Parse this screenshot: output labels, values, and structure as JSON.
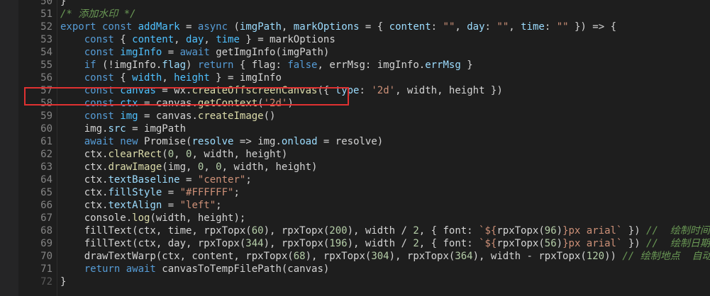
{
  "editor": {
    "lines": [
      {
        "num": "50",
        "dim": false,
        "tokens": [
          {
            "t": "}",
            "c": "d"
          }
        ]
      },
      {
        "num": "51",
        "dim": false,
        "tokens": [
          {
            "t": "/* 添加水印 */",
            "c": "c"
          }
        ]
      },
      {
        "num": "52",
        "dim": false,
        "tokens": [
          {
            "t": "export const ",
            "c": "k"
          },
          {
            "t": "addMark",
            "c": "v"
          },
          {
            "t": " = ",
            "c": "d"
          },
          {
            "t": "async",
            "c": "k"
          },
          {
            "t": " (",
            "c": "d"
          },
          {
            "t": "imgPath",
            "c": "p"
          },
          {
            "t": ", ",
            "c": "d"
          },
          {
            "t": "markOptions",
            "c": "p"
          },
          {
            "t": " = { ",
            "c": "d"
          },
          {
            "t": "content",
            "c": "p"
          },
          {
            "t": ": ",
            "c": "d"
          },
          {
            "t": "\"\"",
            "c": "s"
          },
          {
            "t": ", ",
            "c": "d"
          },
          {
            "t": "day",
            "c": "p"
          },
          {
            "t": ": ",
            "c": "d"
          },
          {
            "t": "\"\"",
            "c": "s"
          },
          {
            "t": ", ",
            "c": "d"
          },
          {
            "t": "time",
            "c": "p"
          },
          {
            "t": ": ",
            "c": "d"
          },
          {
            "t": "\"\"",
            "c": "s"
          },
          {
            "t": " }) => {",
            "c": "d"
          }
        ]
      },
      {
        "num": "53",
        "dim": false,
        "tokens": [
          {
            "t": "    const ",
            "c": "k"
          },
          {
            "t": "{ ",
            "c": "d"
          },
          {
            "t": "content",
            "c": "v"
          },
          {
            "t": ", ",
            "c": "d"
          },
          {
            "t": "day",
            "c": "v"
          },
          {
            "t": ", ",
            "c": "d"
          },
          {
            "t": "time",
            "c": "v"
          },
          {
            "t": " } = markOptions",
            "c": "d"
          }
        ]
      },
      {
        "num": "54",
        "dim": false,
        "tokens": [
          {
            "t": "    const ",
            "c": "k"
          },
          {
            "t": "imgInfo",
            "c": "v"
          },
          {
            "t": " = ",
            "c": "d"
          },
          {
            "t": "await",
            "c": "k"
          },
          {
            "t": " getImgInfo(imgPath)",
            "c": "d"
          }
        ]
      },
      {
        "num": "55",
        "dim": false,
        "tokens": [
          {
            "t": "    if",
            "c": "k"
          },
          {
            "t": " (!imgInfo.",
            "c": "d"
          },
          {
            "t": "flag",
            "c": "p"
          },
          {
            "t": ") ",
            "c": "d"
          },
          {
            "t": "return",
            "c": "k"
          },
          {
            "t": " { flag: ",
            "c": "d"
          },
          {
            "t": "false",
            "c": "k"
          },
          {
            "t": ", errMsg: imgInfo.",
            "c": "d"
          },
          {
            "t": "errMsg",
            "c": "p"
          },
          {
            "t": " }",
            "c": "d"
          }
        ]
      },
      {
        "num": "56",
        "dim": false,
        "tokens": [
          {
            "t": "    const ",
            "c": "k"
          },
          {
            "t": "{ ",
            "c": "d"
          },
          {
            "t": "width",
            "c": "v"
          },
          {
            "t": ", ",
            "c": "d"
          },
          {
            "t": "height",
            "c": "v"
          },
          {
            "t": " } = imgInfo",
            "c": "d"
          }
        ]
      },
      {
        "num": "57",
        "dim": false,
        "tokens": [
          {
            "t": "    const ",
            "c": "k"
          },
          {
            "t": "canvas",
            "c": "v"
          },
          {
            "t": " = wx.",
            "c": "d"
          },
          {
            "t": "createOffscreenCanvas",
            "c": "f"
          },
          {
            "t": "({ ",
            "c": "d"
          },
          {
            "t": "type",
            "c": "p"
          },
          {
            "t": ": ",
            "c": "d"
          },
          {
            "t": "'2d'",
            "c": "s"
          },
          {
            "t": ", width, height })",
            "c": "d"
          }
        ]
      },
      {
        "num": "58",
        "dim": false,
        "tokens": [
          {
            "t": "    const ",
            "c": "k"
          },
          {
            "t": "ctx",
            "c": "v"
          },
          {
            "t": " = canvas.",
            "c": "d"
          },
          {
            "t": "getContext",
            "c": "f"
          },
          {
            "t": "(",
            "c": "d"
          },
          {
            "t": "'2d'",
            "c": "s"
          },
          {
            "t": ")",
            "c": "d"
          }
        ]
      },
      {
        "num": "59",
        "dim": false,
        "tokens": [
          {
            "t": "    const ",
            "c": "k"
          },
          {
            "t": "img",
            "c": "v"
          },
          {
            "t": " = canvas.",
            "c": "d"
          },
          {
            "t": "createImage",
            "c": "f"
          },
          {
            "t": "()",
            "c": "d"
          }
        ]
      },
      {
        "num": "60",
        "dim": false,
        "tokens": [
          {
            "t": "    img.",
            "c": "d"
          },
          {
            "t": "src",
            "c": "p"
          },
          {
            "t": " = imgPath",
            "c": "d"
          }
        ]
      },
      {
        "num": "61",
        "dim": false,
        "tokens": [
          {
            "t": "    await new ",
            "c": "k"
          },
          {
            "t": "Promise",
            "c": "d"
          },
          {
            "t": "(",
            "c": "d"
          },
          {
            "t": "resolve",
            "c": "p"
          },
          {
            "t": " => img.",
            "c": "d"
          },
          {
            "t": "onload",
            "c": "p"
          },
          {
            "t": " = resolve)",
            "c": "d"
          }
        ]
      },
      {
        "num": "62",
        "dim": false,
        "tokens": [
          {
            "t": "    ctx.",
            "c": "d"
          },
          {
            "t": "clearRect",
            "c": "f"
          },
          {
            "t": "(",
            "c": "d"
          },
          {
            "t": "0",
            "c": "n"
          },
          {
            "t": ", ",
            "c": "d"
          },
          {
            "t": "0",
            "c": "n"
          },
          {
            "t": ", width, height)",
            "c": "d"
          }
        ]
      },
      {
        "num": "63",
        "dim": false,
        "tokens": [
          {
            "t": "    ctx.",
            "c": "d"
          },
          {
            "t": "drawImage",
            "c": "f"
          },
          {
            "t": "(img, ",
            "c": "d"
          },
          {
            "t": "0",
            "c": "n"
          },
          {
            "t": ", ",
            "c": "d"
          },
          {
            "t": "0",
            "c": "n"
          },
          {
            "t": ", width, height)",
            "c": "d"
          }
        ]
      },
      {
        "num": "64",
        "dim": false,
        "tokens": [
          {
            "t": "    ctx.",
            "c": "d"
          },
          {
            "t": "textBaseline",
            "c": "p"
          },
          {
            "t": " = ",
            "c": "d"
          },
          {
            "t": "\"center\"",
            "c": "s"
          },
          {
            "t": ";",
            "c": "d"
          }
        ]
      },
      {
        "num": "65",
        "dim": false,
        "tokens": [
          {
            "t": "    ctx.",
            "c": "d"
          },
          {
            "t": "fillStyle",
            "c": "p"
          },
          {
            "t": " = ",
            "c": "d"
          },
          {
            "t": "\"#FFFFFF\"",
            "c": "s"
          },
          {
            "t": ";",
            "c": "d"
          }
        ]
      },
      {
        "num": "66",
        "dim": false,
        "tokens": [
          {
            "t": "    ctx.",
            "c": "d"
          },
          {
            "t": "textAlign",
            "c": "p"
          },
          {
            "t": " = ",
            "c": "d"
          },
          {
            "t": "\"left\"",
            "c": "s"
          },
          {
            "t": ";",
            "c": "d"
          }
        ]
      },
      {
        "num": "67",
        "dim": false,
        "tokens": [
          {
            "t": "    console.",
            "c": "d"
          },
          {
            "t": "log",
            "c": "f"
          },
          {
            "t": "(width, height);",
            "c": "d"
          }
        ]
      },
      {
        "num": "68",
        "dim": false,
        "tokens": [
          {
            "t": "    fillText(ctx, time, rpxTopx(",
            "c": "d"
          },
          {
            "t": "60",
            "c": "n"
          },
          {
            "t": "), rpxTopx(",
            "c": "d"
          },
          {
            "t": "200",
            "c": "n"
          },
          {
            "t": "), width / ",
            "c": "d"
          },
          {
            "t": "2",
            "c": "n"
          },
          {
            "t": ", { font: ",
            "c": "d"
          },
          {
            "t": "`${",
            "c": "s"
          },
          {
            "t": "rpxTopx(",
            "c": "d"
          },
          {
            "t": "96",
            "c": "n"
          },
          {
            "t": ")",
            "c": "d"
          },
          {
            "t": "}px arial`",
            "c": "s"
          },
          {
            "t": " }) ",
            "c": "d"
          },
          {
            "t": "//  绘制时间",
            "c": "c"
          }
        ]
      },
      {
        "num": "69",
        "dim": false,
        "tokens": [
          {
            "t": "    fillText(ctx, day, rpxTopx(",
            "c": "d"
          },
          {
            "t": "344",
            "c": "n"
          },
          {
            "t": "), rpxTopx(",
            "c": "d"
          },
          {
            "t": "196",
            "c": "n"
          },
          {
            "t": "), width / ",
            "c": "d"
          },
          {
            "t": "2",
            "c": "n"
          },
          {
            "t": ", { font: ",
            "c": "d"
          },
          {
            "t": "`${",
            "c": "s"
          },
          {
            "t": "rpxTopx(",
            "c": "d"
          },
          {
            "t": "56",
            "c": "n"
          },
          {
            "t": ")",
            "c": "d"
          },
          {
            "t": "}px arial`",
            "c": "s"
          },
          {
            "t": " }) ",
            "c": "d"
          },
          {
            "t": "//  绘制日期",
            "c": "c"
          }
        ]
      },
      {
        "num": "70",
        "dim": false,
        "tokens": [
          {
            "t": "    drawTextWarp(ctx, content, rpxTopx(",
            "c": "d"
          },
          {
            "t": "68",
            "c": "n"
          },
          {
            "t": "), rpxTopx(",
            "c": "d"
          },
          {
            "t": "304",
            "c": "n"
          },
          {
            "t": "), rpxTopx(",
            "c": "d"
          },
          {
            "t": "364",
            "c": "n"
          },
          {
            "t": "), width - rpxTopx(",
            "c": "d"
          },
          {
            "t": "120",
            "c": "n"
          },
          {
            "t": ")) ",
            "c": "d"
          },
          {
            "t": "// 绘制地点  自动换",
            "c": "c"
          }
        ]
      },
      {
        "num": "71",
        "dim": false,
        "tokens": [
          {
            "t": "    return await ",
            "c": "k"
          },
          {
            "t": "canvasToTempFilePath(canvas)",
            "c": "d"
          }
        ]
      },
      {
        "num": "72",
        "dim": true,
        "tokens": [
          {
            "t": "}",
            "c": "d"
          }
        ]
      }
    ]
  },
  "highlight": {
    "line": "58"
  },
  "colors": {
    "background": "#1e1e1e",
    "highlight_border": "#e03131"
  }
}
